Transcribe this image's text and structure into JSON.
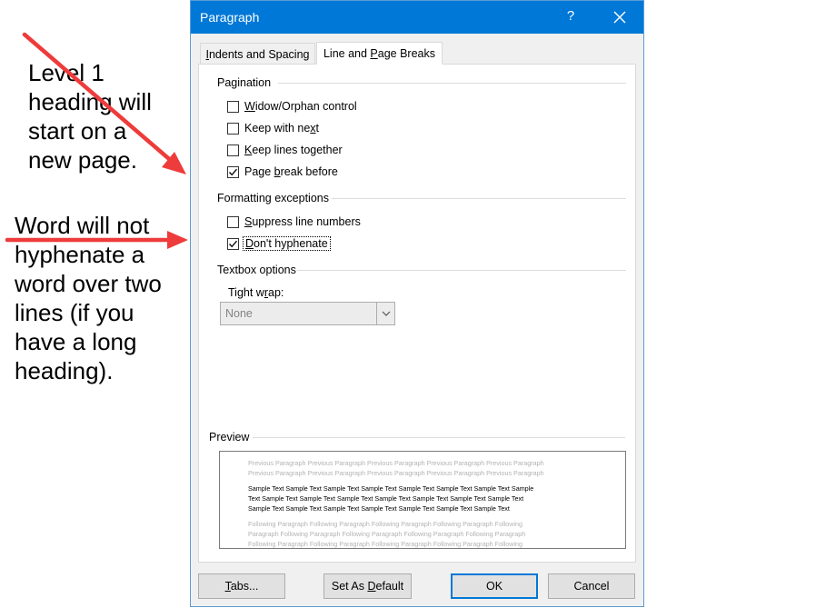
{
  "annotations": {
    "note1": [
      "Level 1",
      "heading will",
      "start on a",
      "new page."
    ],
    "note2": [
      "Word will not",
      "hyphenate a",
      "word over two",
      "lines (if you",
      "have a long",
      "heading)."
    ],
    "arrow_color": "#ee3b3b"
  },
  "dialog": {
    "title": "Paragraph",
    "help": "?",
    "tabs": [
      {
        "label": "Indents and Spacing",
        "underline": "I",
        "rest": "ndents and Spacing"
      },
      {
        "label": "Line and Page Breaks",
        "pre": "Line and ",
        "underline": "P",
        "rest": "age Breaks",
        "active": true
      }
    ],
    "pagination": {
      "heading": "Pagination",
      "items": [
        {
          "pre": "",
          "u": "W",
          "post": "idow/Orphan control",
          "checked": false
        },
        {
          "pre": "Keep with ne",
          "u": "x",
          "post": "t",
          "checked": false
        },
        {
          "pre": "",
          "u": "K",
          "post": "eep lines together",
          "checked": false
        },
        {
          "pre": "Page ",
          "u": "b",
          "post": "reak before",
          "checked": true
        }
      ]
    },
    "formatting": {
      "heading": "Formatting exceptions",
      "items": [
        {
          "pre": "",
          "u": "S",
          "post": "uppress line numbers",
          "checked": false
        },
        {
          "pre": "",
          "u": "D",
          "post": "on't hyphenate",
          "checked": true,
          "focused": true
        }
      ]
    },
    "textbox": {
      "heading": "Textbox options",
      "tight_wrap_pre": "Tight w",
      "tight_wrap_u": "r",
      "tight_wrap_post": "ap:",
      "tight_wrap_value": "None"
    },
    "preview": {
      "heading": "Preview",
      "previous": [
        "Previous Paragraph Previous Paragraph Previous Paragraph Previous Paragraph Previous Paragraph",
        "Previous Paragraph Previous Paragraph Previous Paragraph Previous Paragraph Previous Paragraph"
      ],
      "sample": [
        "Sample Text Sample Text Sample Text Sample Text Sample Text Sample Text Sample Text Sample",
        "Text Sample Text Sample Text Sample Text Sample Text Sample Text Sample Text Sample Text",
        "Sample Text Sample Text Sample Text Sample Text Sample Text Sample Text Sample Text"
      ],
      "following": [
        "Following Paragraph Following Paragraph Following Paragraph Following Paragraph Following",
        "Paragraph Following Paragraph Following Paragraph Following Paragraph Following Paragraph",
        "Following Paragraph Following Paragraph Following Paragraph Following Paragraph Following"
      ]
    },
    "buttons": {
      "tabs_u": "T",
      "tabs_rest": "abs...",
      "default_pre": "Set As ",
      "default_u": "D",
      "default_post": "efault",
      "ok": "OK",
      "cancel": "Cancel"
    },
    "colors": {
      "titlebar": "#0078d7",
      "window_bg": "#f0f0f0",
      "panel_bg": "#ffffff",
      "disabled_text": "#838383"
    }
  }
}
